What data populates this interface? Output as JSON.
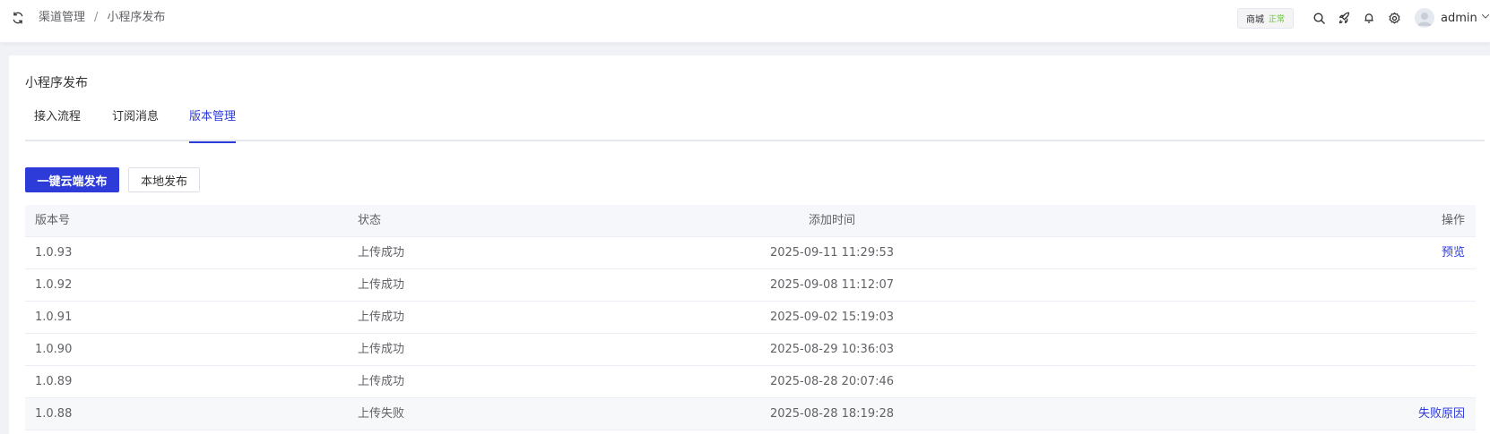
{
  "header": {
    "breadcrumb": [
      "渠道管理",
      "小程序发布"
    ],
    "breadcrumb_separator": "/",
    "shop_badge": {
      "name": "商城",
      "status": "正常"
    },
    "user": {
      "name": "admin"
    },
    "icons": [
      "refresh-icon",
      "search-icon",
      "rocket-icon",
      "bell-icon",
      "gear-icon",
      "avatar",
      "chevron-down-icon"
    ]
  },
  "page": {
    "title": "小程序发布",
    "tabs": [
      {
        "label": "接入流程",
        "active": false
      },
      {
        "label": "订阅消息",
        "active": false
      },
      {
        "label": "版本管理",
        "active": true
      }
    ],
    "buttons": {
      "cloud_publish": "一键云端发布",
      "local_publish": "本地发布"
    }
  },
  "table": {
    "columns": [
      "版本号",
      "状态",
      "添加时间",
      "操作"
    ],
    "rows": [
      {
        "version": "1.0.93",
        "status": "上传成功",
        "time": "2025-09-11 11:29:53",
        "action": "预览"
      },
      {
        "version": "1.0.92",
        "status": "上传成功",
        "time": "2025-09-08 11:12:07",
        "action": ""
      },
      {
        "version": "1.0.91",
        "status": "上传成功",
        "time": "2025-09-02 15:19:03",
        "action": ""
      },
      {
        "version": "1.0.90",
        "status": "上传成功",
        "time": "2025-08-29 10:36:03",
        "action": ""
      },
      {
        "version": "1.0.89",
        "status": "上传成功",
        "time": "2025-08-28 20:07:46",
        "action": ""
      },
      {
        "version": "1.0.88",
        "status": "上传失败",
        "time": "2025-08-28 18:19:28",
        "action": "失败原因"
      }
    ]
  },
  "colors": {
    "primary": "#2d3bd8",
    "success": "#67c23a",
    "text": "#303133",
    "muted": "#606266"
  }
}
